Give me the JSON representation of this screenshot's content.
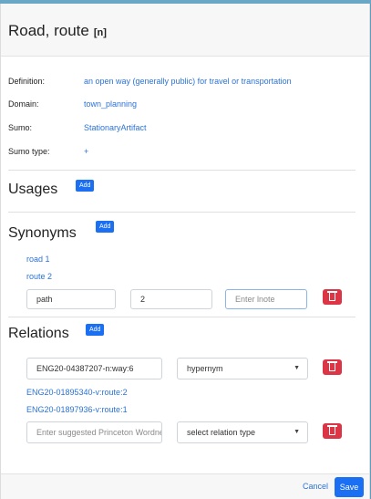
{
  "header": {
    "title": "Road, route",
    "pos": "[n]"
  },
  "details": {
    "definition": {
      "label": "Definition:",
      "value": "an open way (generally public) for travel or transportation"
    },
    "domain": {
      "label": "Domain:",
      "value": "town_planning"
    },
    "sumo": {
      "label": "Sumo:",
      "value": "StationaryArtifact"
    },
    "sumo_type": {
      "label": "Sumo type:",
      "value": "+"
    }
  },
  "usages": {
    "title": "Usages",
    "add_label": "Add"
  },
  "synonyms": {
    "title": "Synonyms",
    "add_label": "Add",
    "items": [
      "road 1",
      "route 2"
    ],
    "new_entry": {
      "word": "path",
      "number": "2",
      "note_placeholder": "Enter lnote"
    }
  },
  "relations": {
    "title": "Relations",
    "add_label": "Add",
    "first": {
      "target": "ENG20-04387207-n:way:6",
      "type": "hypernym"
    },
    "items": [
      "ENG20-01895340-v:route:2",
      "ENG20-01897936-v:route:1"
    ],
    "new_entry": {
      "target_placeholder": "Enter suggested Princeton Wordnet",
      "type_placeholder": "select relation type"
    }
  },
  "footer": {
    "cancel_label": "Cancel",
    "save_label": "Save"
  },
  "colors": {
    "primary": "#1a6ff2",
    "danger": "#dc3545",
    "link": "#2a73d8"
  },
  "icons": {
    "delete": "trash-icon",
    "dropdown": "caret-down-icon"
  }
}
